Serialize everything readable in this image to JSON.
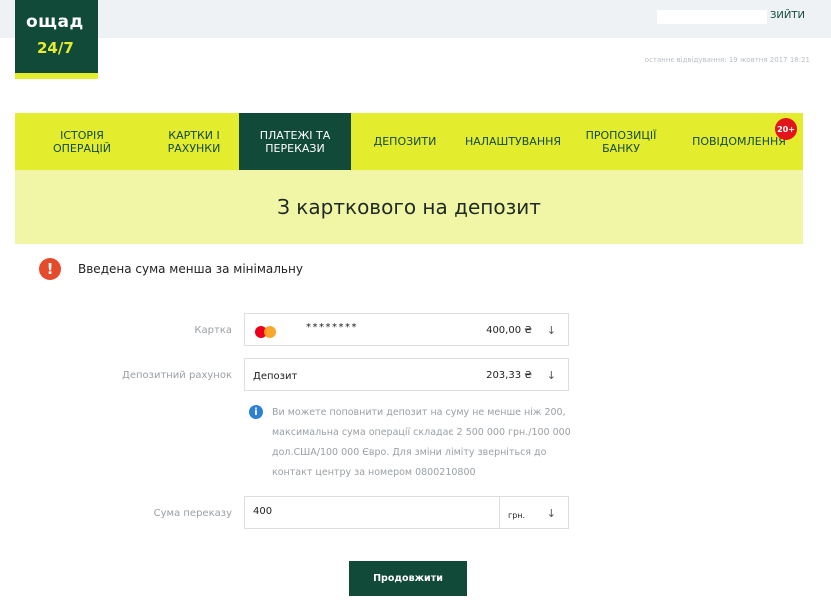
{
  "header": {
    "logo_line1": "ощад",
    "logo_line2": "24/7",
    "logout": "ЗИЙТИ",
    "last_visit": "останнє відвідування: 19 жовтня 2017 18:21"
  },
  "nav": {
    "items": [
      {
        "label": "ІСТОРІЯ ОПЕРАЦІЙ"
      },
      {
        "label": "КАРТКИ І РАХУНКИ"
      },
      {
        "label": "ПЛАТЕЖІ ТА ПЕРЕКАЗИ",
        "active": true
      },
      {
        "label": "ДЕПОЗИТИ"
      },
      {
        "label": "НАЛАШТУВАННЯ"
      },
      {
        "label": "ПРОПОЗИЦІЇ БАНКУ"
      },
      {
        "label": "ПОВІДОМЛЕННЯ",
        "badge": "20+"
      }
    ]
  },
  "page": {
    "title": "З карткового на депозит"
  },
  "error": {
    "icon": "exclamation-icon",
    "text": "Введена сума менша за мінімальну"
  },
  "form": {
    "card": {
      "label": "Картка",
      "icon": "mastercard-icon",
      "masked_number": "********",
      "amount": "400,00 ₴"
    },
    "deposit": {
      "label": "Депозитний рахунок",
      "value": "Депозит",
      "amount": "203,33 ₴"
    },
    "info": "Ви можете поповнити депозит на суму не менше ніж 200, максимальна сума операції складає 2 500 000 грн./100 000 дол.США/100 000 Євро. Для зміни ліміту зверніться до контакт центру за номером 0800210800",
    "sum": {
      "label": "Сума переказу",
      "value": "400",
      "currency": "грн."
    },
    "submit_label": "Продовжити"
  },
  "colors": {
    "brand_dark": "#124a3a",
    "brand_yellow": "#e4ec2e",
    "banner": "#f1f5a6",
    "error": "#e54a2a",
    "info": "#2e7fd8"
  }
}
